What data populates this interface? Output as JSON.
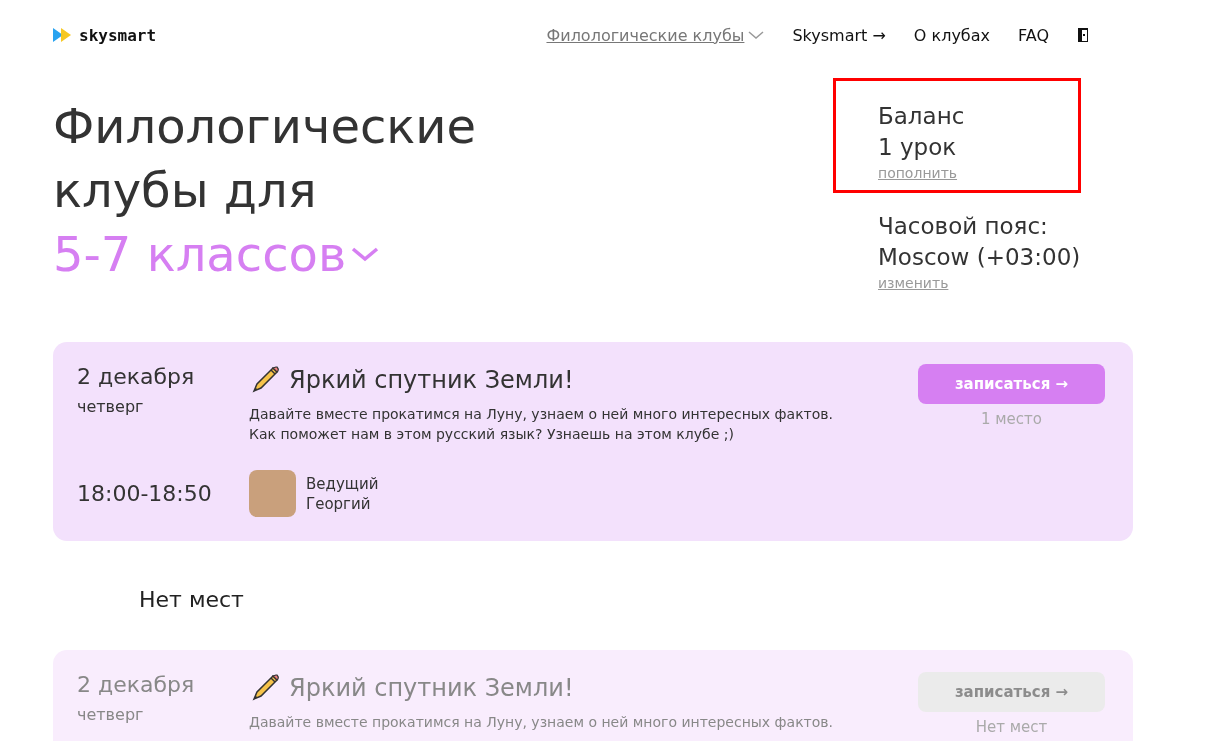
{
  "header": {
    "logo": "skysmart",
    "nav": [
      {
        "label": "Филологические клубы",
        "kind": "dropdown",
        "selected": true
      },
      {
        "label": "Skysmart →",
        "kind": "link",
        "selected": false
      },
      {
        "label": "О клубах",
        "kind": "link",
        "selected": false
      },
      {
        "label": "FAQ",
        "kind": "link",
        "selected": false
      }
    ]
  },
  "hero": {
    "title_lines": [
      "Филологические",
      "клубы для"
    ],
    "grade": "5-7 классов"
  },
  "balance": {
    "label": "Баланс",
    "value": "1 урок",
    "action": "пополнить",
    "highlighted": true
  },
  "timezone": {
    "label": "Часовой пояс:",
    "value": "Moscow (+03:00)",
    "action": "изменить"
  },
  "clubs": [
    {
      "date": "2 декабря",
      "weekday": "четверг",
      "title": "Яркий спутник Земли!",
      "description": "Давайте вместе прокатимся на Луну, узнаем о ней много интересных фактов. Как поможет нам в этом русский язык? Узнаешь на этом клубе ;)",
      "time": "18:00-18:50",
      "host_label": "Ведущий",
      "host_name": "Георгий",
      "button": "записаться →",
      "seats": "1 место",
      "disabled": false
    }
  ],
  "full_section": {
    "heading": "Нет мест",
    "clubs": [
      {
        "date": "2 декабря",
        "weekday": "четверг",
        "title": "Яркий спутник Земли!",
        "description": "Давайте вместе прокатимся на Луну, узнаем о ней много интересных фактов.",
        "button": "записаться →",
        "seats": "Нет мест",
        "disabled": true
      }
    ]
  }
}
